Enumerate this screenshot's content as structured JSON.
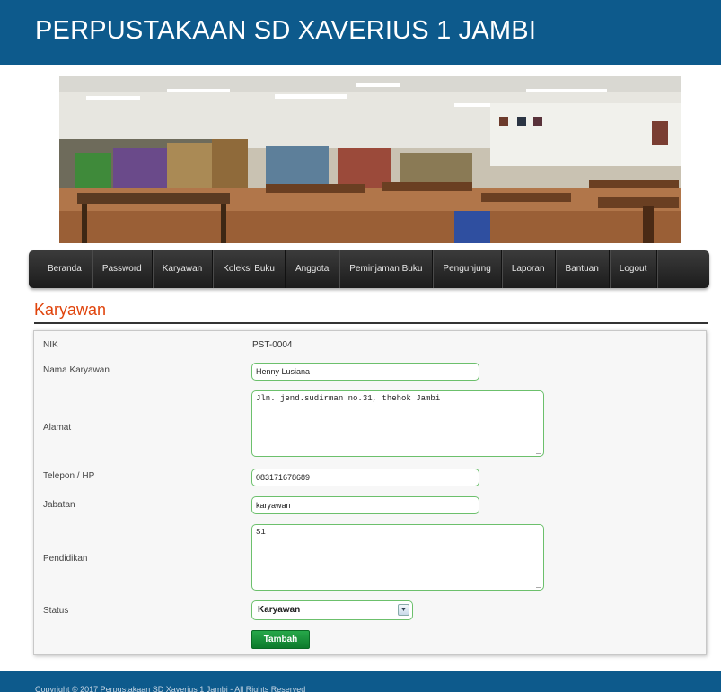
{
  "site": {
    "title": "PERPUSTAKAAN SD XAVERIUS 1 JAMBI"
  },
  "nav": {
    "items": [
      "Beranda",
      "Password",
      "Karyawan",
      "Koleksi Buku",
      "Anggota",
      "Peminjaman Buku",
      "Pengunjung",
      "Laporan",
      "Bantuan",
      "Logout"
    ]
  },
  "page": {
    "heading": "Karyawan"
  },
  "form": {
    "nik_label": "NIK",
    "nik_value": "PST-0004",
    "nama_label": "Nama Karyawan",
    "nama_value": "Henny Lusiana",
    "alamat_label": "Alamat",
    "alamat_value": "Jln. jend.sudirman no.31, thehok Jambi",
    "telepon_label": "Telepon / HP",
    "telepon_value": "083171678689",
    "jabatan_label": "Jabatan",
    "jabatan_value": "karyawan",
    "pendidikan_label": "Pendidikan",
    "pendidikan_value": "S1",
    "status_label": "Status",
    "status_value": "Karyawan",
    "submit_label": "Tambah"
  },
  "footer": {
    "text": "Copyright © 2017 Perpustakaan SD Xaverius 1 Jambi - All Rights Reserved"
  },
  "colors": {
    "header": "#0d5a8c",
    "heading": "#e0440c",
    "input_border": "#6cc06c",
    "button": "#1a8f3a"
  }
}
